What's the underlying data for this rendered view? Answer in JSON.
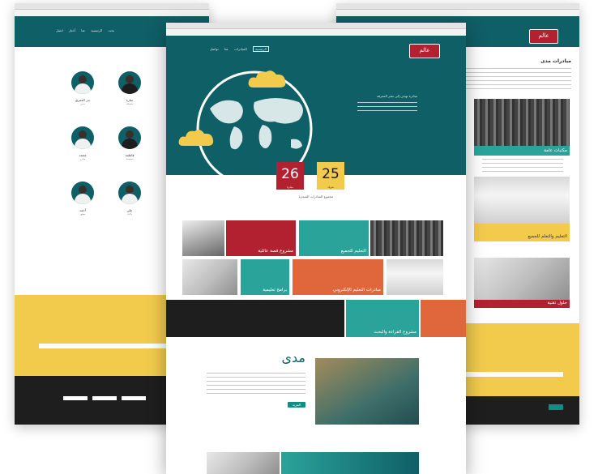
{
  "left_page": {
    "nav_items": [
      "بحث",
      "الرئيسية",
      "عنا",
      "أخبار",
      "اتصل"
    ],
    "people": [
      {
        "name": "بدر العمري",
        "role": "مدير"
      },
      {
        "name": "سارة",
        "role": "منسقة"
      },
      {
        "name": "محمد",
        "role": "محرر"
      },
      {
        "name": "فاطمة",
        "role": "مصممة"
      },
      {
        "name": "أحمد",
        "role": "مطور"
      },
      {
        "name": "علي",
        "role": "باحث"
      }
    ]
  },
  "center_page": {
    "logo_text": "عالم",
    "nav_items": [
      "الرئيسية",
      "المبادرات",
      "عنا",
      "تواصل"
    ],
    "hero_text": "مبادرة تهدف إلى نشر المعرفة",
    "counters": [
      {
        "value": "26",
        "label": "مبادرة"
      },
      {
        "value": "25",
        "label": "شريك"
      }
    ],
    "counter_caption": "مجموع المبادرات المنجزة",
    "tiles": [
      {
        "label": "مشروع قصة عائلية"
      },
      {
        "label": "التعليم للجميع"
      },
      {
        "label": "مبادرات التعليم الإلكتروني"
      },
      {
        "label": "برامج تعليمية"
      },
      {
        "label": "مشروع القراءة والبحث"
      }
    ],
    "madar_logo": "مدى",
    "more_button": "المزيد"
  },
  "right_page": {
    "logo_text": "عالم",
    "title": "مبادرات مدى",
    "cards": [
      {
        "label": "مكتبات عامة"
      },
      {
        "label": "التعليم والتعلم للجميع"
      },
      {
        "label": "حلول تقنية"
      }
    ]
  },
  "colors": {
    "teal": "#0f5f66",
    "red": "#b2212f",
    "yellow": "#f2cb4d",
    "orange": "#e0663b",
    "green": "#2aa39a"
  }
}
